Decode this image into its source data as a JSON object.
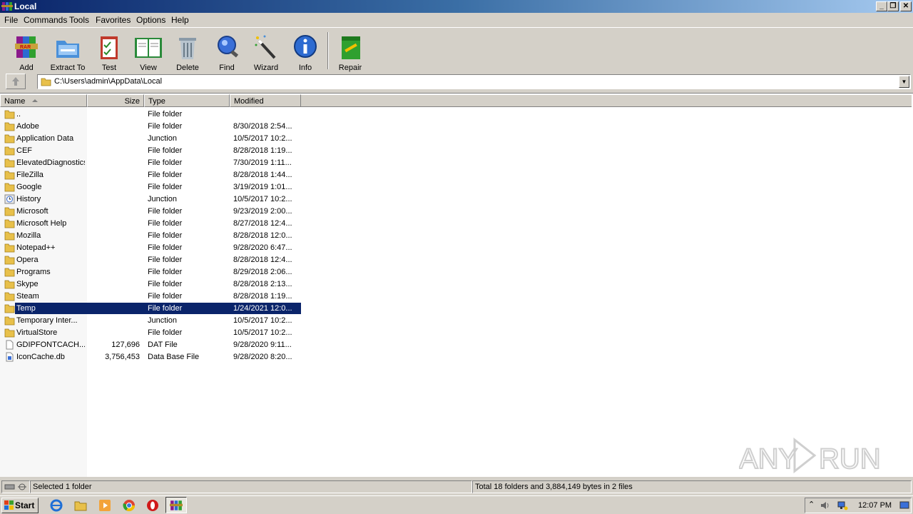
{
  "window": {
    "title": "Local"
  },
  "menu": [
    "File",
    "Commands",
    "Tools",
    "Favorites",
    "Options",
    "Help"
  ],
  "toolbar": {
    "buttons": [
      {
        "label": "Add",
        "icon": "add-archive-icon"
      },
      {
        "label": "Extract To",
        "icon": "extract-folder-icon"
      },
      {
        "label": "Test",
        "icon": "test-clipboard-icon"
      },
      {
        "label": "View",
        "icon": "view-book-icon"
      },
      {
        "label": "Delete",
        "icon": "trash-can-icon"
      },
      {
        "label": "Find",
        "icon": "magnifier-icon"
      },
      {
        "label": "Wizard",
        "icon": "magic-wand-icon"
      },
      {
        "label": "Info",
        "icon": "info-icon"
      },
      {
        "label": "Repair",
        "icon": "repair-kit-icon"
      }
    ]
  },
  "address": {
    "path": "C:\\Users\\admin\\AppData\\Local"
  },
  "columns": {
    "name": "Name",
    "size": "Size",
    "type": "Type",
    "modified": "Modified"
  },
  "rows": [
    {
      "name": "..",
      "size": "",
      "type": "File folder",
      "modified": "",
      "icon": "folder-icon"
    },
    {
      "name": "Adobe",
      "size": "",
      "type": "File folder",
      "modified": "8/30/2018 2:54...",
      "icon": "folder-icon"
    },
    {
      "name": "Application Data",
      "size": "",
      "type": "Junction",
      "modified": "10/5/2017 10:2...",
      "icon": "folder-icon"
    },
    {
      "name": "CEF",
      "size": "",
      "type": "File folder",
      "modified": "8/28/2018 1:19...",
      "icon": "folder-icon"
    },
    {
      "name": "ElevatedDiagnostics",
      "size": "",
      "type": "File folder",
      "modified": "7/30/2019 1:11...",
      "icon": "folder-icon"
    },
    {
      "name": "FileZilla",
      "size": "",
      "type": "File folder",
      "modified": "8/28/2018 1:44...",
      "icon": "folder-icon"
    },
    {
      "name": "Google",
      "size": "",
      "type": "File folder",
      "modified": "3/19/2019 1:01...",
      "icon": "folder-icon"
    },
    {
      "name": "History",
      "size": "",
      "type": "Junction",
      "modified": "10/5/2017 10:2...",
      "icon": "history-icon"
    },
    {
      "name": "Microsoft",
      "size": "",
      "type": "File folder",
      "modified": "9/23/2019 2:00...",
      "icon": "folder-icon"
    },
    {
      "name": "Microsoft Help",
      "size": "",
      "type": "File folder",
      "modified": "8/27/2018 12:4...",
      "icon": "folder-icon"
    },
    {
      "name": "Mozilla",
      "size": "",
      "type": "File folder",
      "modified": "8/28/2018 12:0...",
      "icon": "folder-icon"
    },
    {
      "name": "Notepad++",
      "size": "",
      "type": "File folder",
      "modified": "9/28/2020 6:47...",
      "icon": "folder-icon"
    },
    {
      "name": "Opera",
      "size": "",
      "type": "File folder",
      "modified": "8/28/2018 12:4...",
      "icon": "folder-icon"
    },
    {
      "name": "Programs",
      "size": "",
      "type": "File folder",
      "modified": "8/29/2018 2:06...",
      "icon": "folder-icon"
    },
    {
      "name": "Skype",
      "size": "",
      "type": "File folder",
      "modified": "8/28/2018 2:13...",
      "icon": "folder-icon"
    },
    {
      "name": "Steam",
      "size": "",
      "type": "File folder",
      "modified": "8/28/2018 1:19...",
      "icon": "folder-icon"
    },
    {
      "name": "Temp",
      "size": "",
      "type": "File folder",
      "modified": "1/24/2021 12:0...",
      "icon": "folder-icon",
      "selected": true
    },
    {
      "name": "Temporary Inter...",
      "size": "",
      "type": "Junction",
      "modified": "10/5/2017 10:2...",
      "icon": "folder-icon"
    },
    {
      "name": "VirtualStore",
      "size": "",
      "type": "File folder",
      "modified": "10/5/2017 10:2...",
      "icon": "folder-icon"
    },
    {
      "name": "GDIPFONTCACH...",
      "size": "127,696",
      "type": "DAT File",
      "modified": "9/28/2020 9:11...",
      "icon": "file-icon"
    },
    {
      "name": "IconCache.db",
      "size": "3,756,453",
      "type": "Data Base File",
      "modified": "9/28/2020 8:20...",
      "icon": "database-file-icon"
    }
  ],
  "status": {
    "left": "Selected 1 folder",
    "right": "Total 18 folders and 3,884,149 bytes in 2 files"
  },
  "watermark": "ANY RUN",
  "taskbar": {
    "start": "Start",
    "clock": "12:07 PM"
  }
}
